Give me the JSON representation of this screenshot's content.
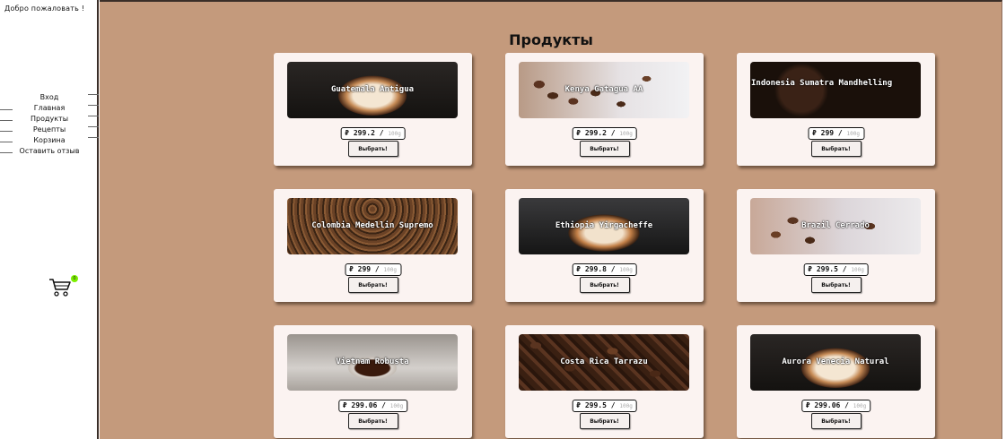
{
  "sidebar": {
    "welcome": "Добро  пожаловать  !",
    "nav": [
      {
        "label": "Вход",
        "key": "login"
      },
      {
        "label": "Главная",
        "key": "home"
      },
      {
        "label": "Продукты",
        "key": "products"
      },
      {
        "label": "Рецепты",
        "key": "recipes"
      },
      {
        "label": "Корзина",
        "key": "cart"
      },
      {
        "label": "Оставить  отзыв",
        "key": "feedback"
      }
    ],
    "cart_icon": "shopping-cart-icon",
    "cart_count": "0"
  },
  "main": {
    "title": "Продукты",
    "select_label": "Выбрать!",
    "currency": "₽",
    "unit": "100g",
    "products": [
      {
        "name": "Guatemala Antigua",
        "price": "299.2",
        "image": "latte-art"
      },
      {
        "name": "Kenya Gatagua AA",
        "price": "299.2",
        "image": "coffee-beans"
      },
      {
        "name": "Indonesia Sumatra Mandhelling",
        "price": "299",
        "image": "coffee-scoop"
      },
      {
        "name": "Colombia Medellin Supremo",
        "price": "299",
        "image": "roaster-beans"
      },
      {
        "name": "Ethiopia Yirgacheffe",
        "price": "299.8",
        "image": "latte-art"
      },
      {
        "name": "Brazil Cerrado",
        "price": "299.5",
        "image": "coffee-beans"
      },
      {
        "name": "Vietnam Robusta",
        "price": "299.06",
        "image": "coffee-cup"
      },
      {
        "name": "Costa Rica Tarrazu",
        "price": "299.5",
        "image": "coffee-beans"
      },
      {
        "name": "Aurora Venecia Natural",
        "price": "299.06",
        "image": "latte-art"
      }
    ]
  },
  "colors": {
    "main_bg": "#c49a7c",
    "card_bg": "#fbf3f1",
    "badge": "#7cf000"
  }
}
